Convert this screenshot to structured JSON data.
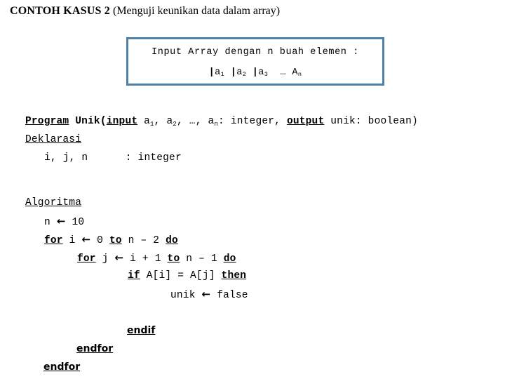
{
  "title": {
    "bold_part": "CONTOH KASUS 2",
    "normal_part": " (Menguji keunikan data dalam array)"
  },
  "input_box": {
    "caption": "Input Array dengan n buah elemen :",
    "elements_plain": "|a1 |a2 |a3  … An",
    "border_color": "#4f81a8",
    "element_cells": [
      {
        "bar": "|",
        "name": "a",
        "index": "1"
      },
      {
        "bar": "|",
        "name": "a",
        "index": "2"
      },
      {
        "bar": "|",
        "name": "a",
        "index": "3"
      },
      {
        "bar": "",
        "name": "…",
        "index": ""
      },
      {
        "bar": "",
        "name": "A",
        "index": "n"
      }
    ]
  },
  "pseudocode": {
    "header": {
      "program_kw": "Program",
      "proc_name": " Unik(",
      "input_kw": "input",
      "params": " a",
      "p1": "1",
      "params2": ", a",
      "p2": "2",
      "params3": ", …, a",
      "p3": "n",
      "params4": ": integer, ",
      "output_kw": "output",
      "tail": " unik: boolean)"
    },
    "deklarasi_label": "Deklarasi",
    "deklarasi_vars": "i, j, n",
    "deklarasi_sep": ":",
    "deklarasi_type": "integer",
    "algoritma_label": "Algoritma",
    "assign_n_var": "n",
    "assign_arrow": "←",
    "assign_n_value": "10",
    "for1_kw": "for",
    "for1_var": "i",
    "for1_arrow": "←",
    "for1_start": "0",
    "for1_to": "to",
    "for1_end": "n – 2",
    "for1_do": "do",
    "for2_kw": "for",
    "for2_var": "j",
    "for2_arrow": "←",
    "for2_start": "i + 1",
    "for2_to": "to",
    "for2_end": "n – 1",
    "for2_do": "do",
    "if_kw": "if",
    "if_cond": "A[i] = A[j]",
    "if_then": "then",
    "body_var": "unik",
    "body_arrow": "←",
    "body_value": "false",
    "endif": "endif",
    "endfor_inner": "endfor",
    "endfor_outer": "endfor"
  }
}
